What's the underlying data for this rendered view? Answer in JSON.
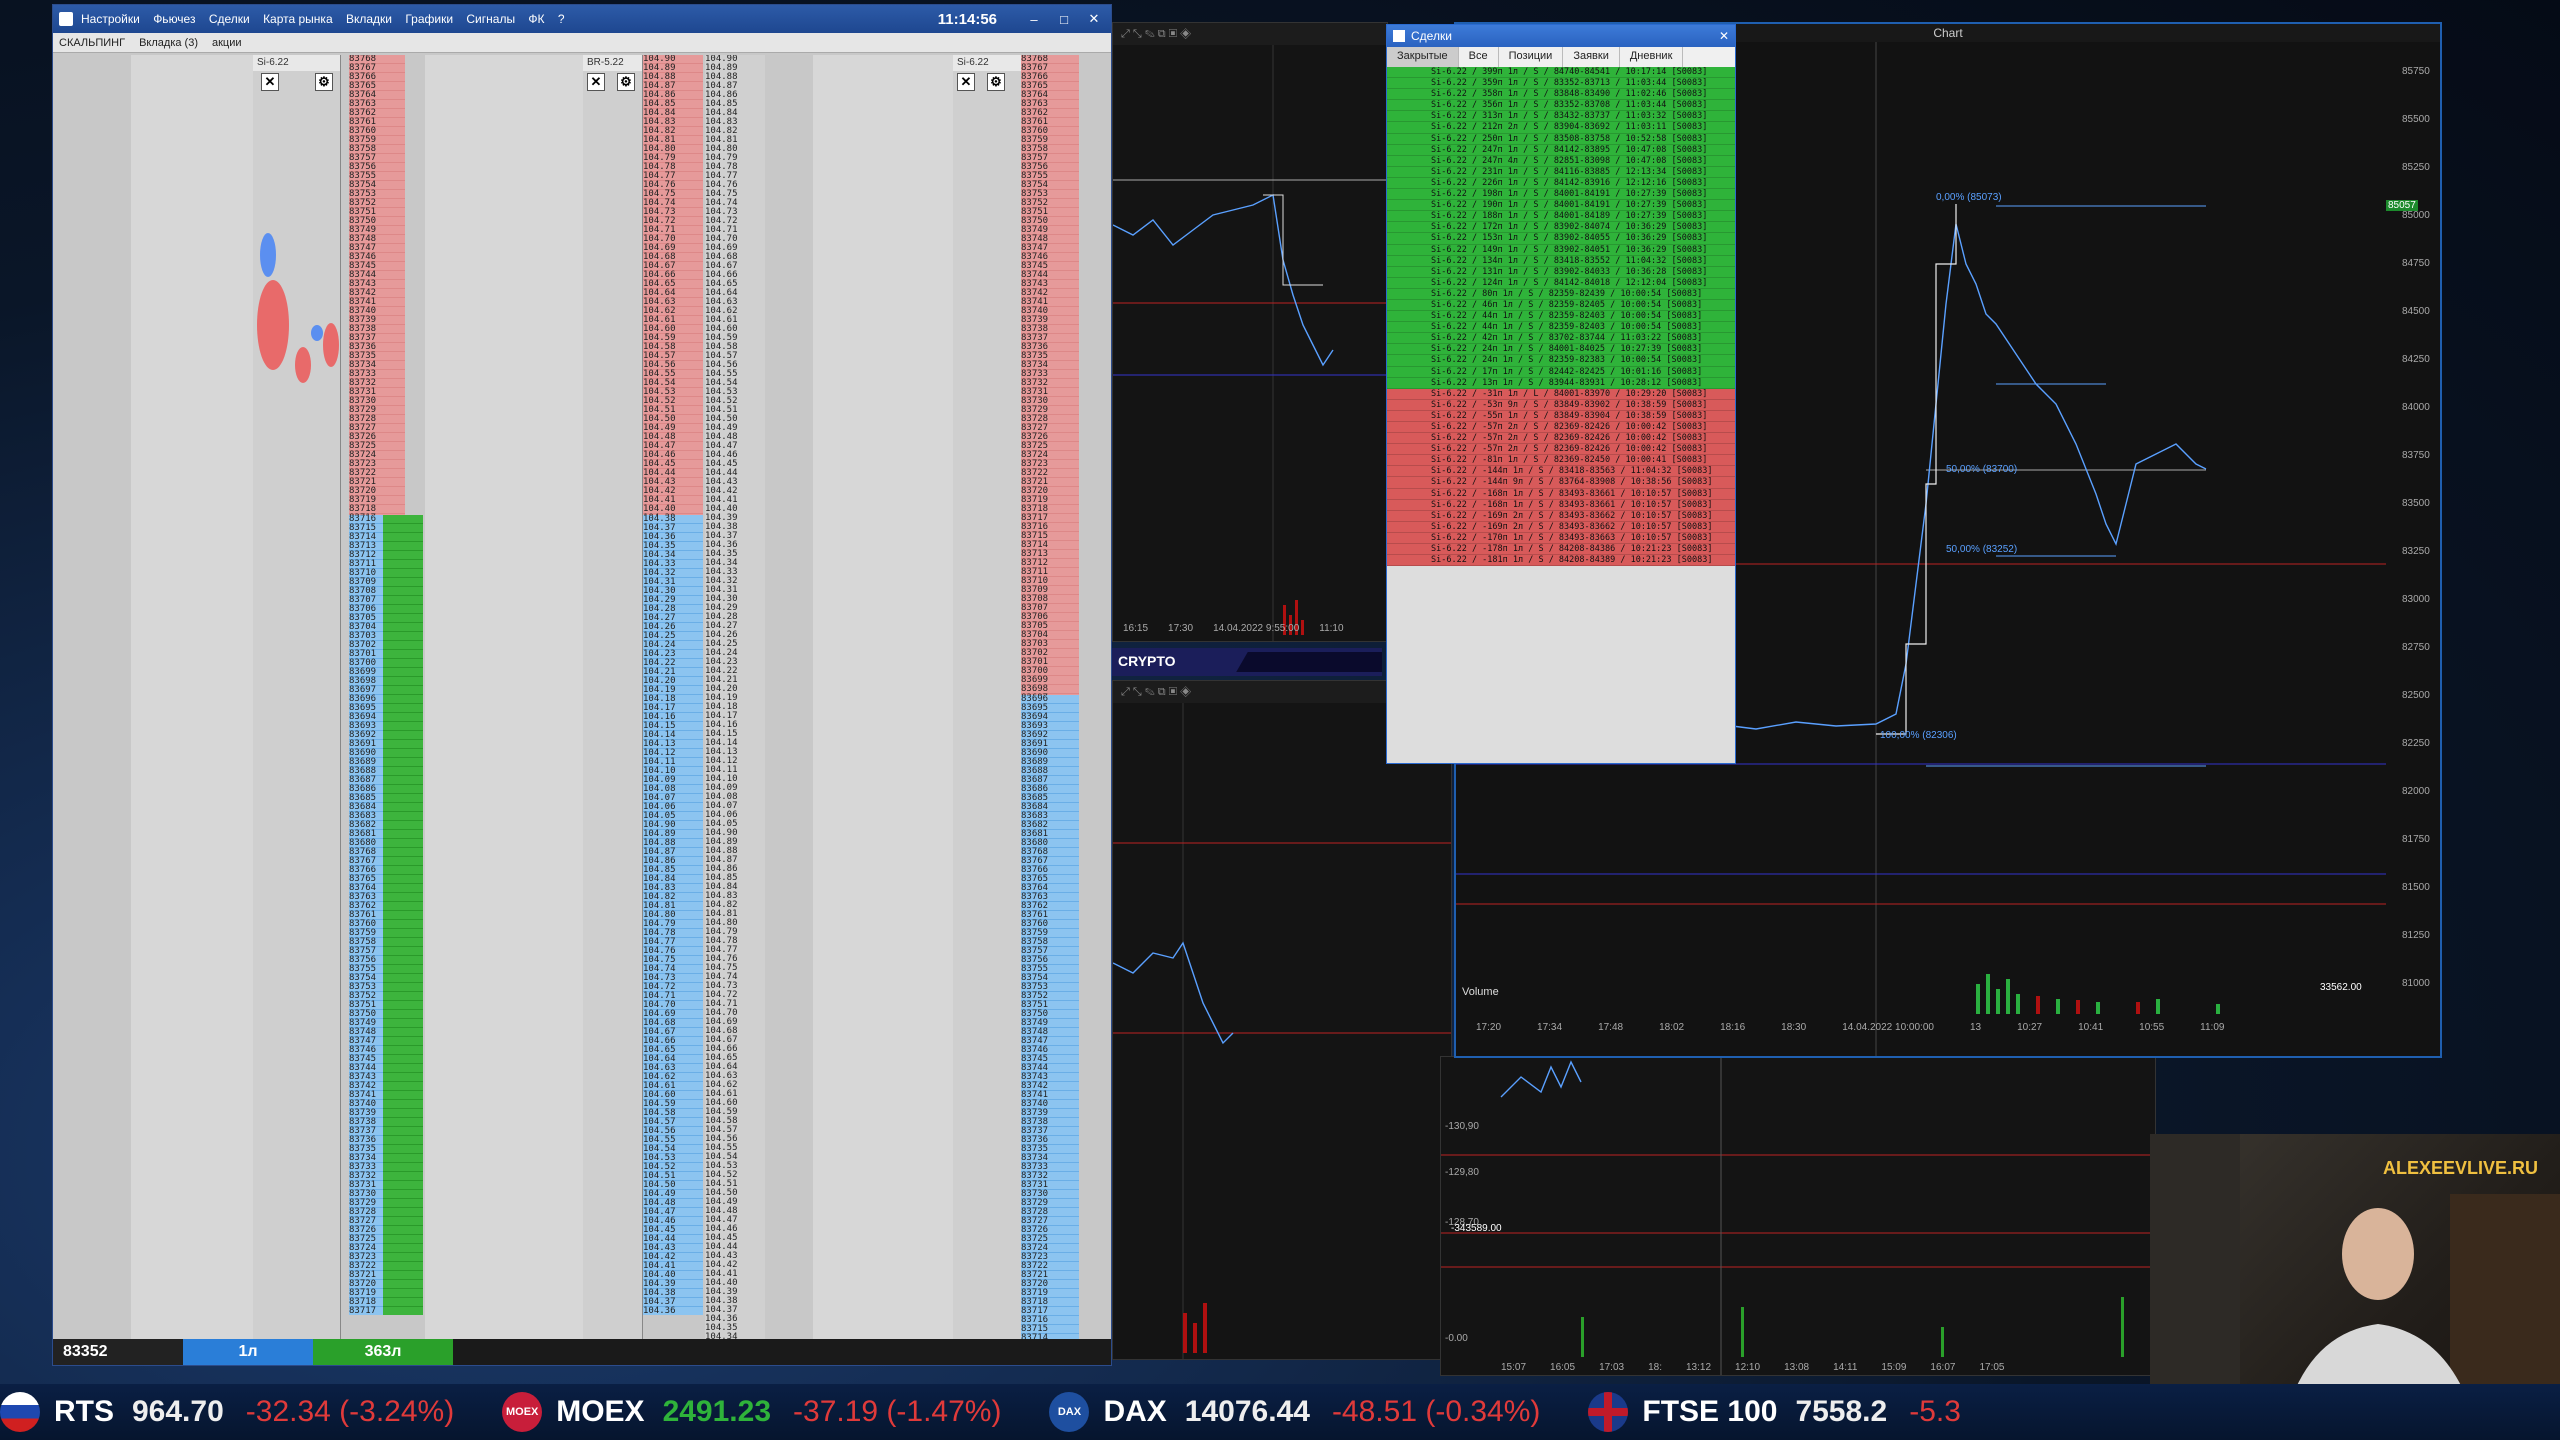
{
  "terminal": {
    "menu": [
      "Настройки",
      "Фьючез",
      "Сделки",
      "Карта рынка",
      "Вкладки",
      "Графики",
      "Сигналы",
      "ФК",
      "?"
    ],
    "clock": "11:14:56",
    "tabs": [
      "СКАЛЬПИНГ",
      "Вкладка (3)",
      "акции"
    ],
    "ladders": [
      {
        "name": "Si-6.22",
        "header_alt": "BR-5.22"
      },
      {
        "name": "Si-6.22"
      }
    ],
    "price_col1": [
      "83768",
      "83767",
      "83766",
      "83765",
      "83764",
      "83763",
      "83762",
      "83761",
      "83760",
      "83759",
      "83758",
      "83757",
      "83756",
      "83755",
      "83754",
      "83753",
      "83752",
      "83751",
      "83750",
      "83749",
      "83748",
      "83747",
      "83746",
      "83745",
      "83744",
      "83743",
      "83742",
      "83741",
      "83740",
      "83739",
      "83738",
      "83737",
      "83736",
      "83735",
      "83734",
      "83733",
      "83732",
      "83731",
      "83730",
      "83729",
      "83728",
      "83727",
      "83726",
      "83725",
      "83724",
      "83723",
      "83722",
      "83721",
      "83720",
      "83719",
      "83718",
      "83717",
      "83716",
      "83715",
      "83714",
      "83713",
      "83712",
      "83711",
      "83710",
      "83709",
      "83708",
      "83707",
      "83706",
      "83705",
      "83704",
      "83703",
      "83702",
      "83701",
      "83700",
      "83699",
      "83698",
      "83697",
      "83696",
      "83695",
      "83694",
      "83693",
      "83692",
      "83691",
      "83690",
      "83689",
      "83688",
      "83687",
      "83686",
      "83685",
      "83684",
      "83683",
      "83682",
      "83681",
      "83680"
    ],
    "price_col2": [
      "104.90",
      "104.89",
      "104.88",
      "104.87",
      "104.86",
      "104.85",
      "104.84",
      "104.83",
      "104.82",
      "104.81",
      "104.80",
      "104.79",
      "104.78",
      "104.77",
      "104.76",
      "104.75",
      "104.74",
      "104.73",
      "104.72",
      "104.71",
      "104.70",
      "104.69",
      "104.68",
      "104.67",
      "104.66",
      "104.65",
      "104.64",
      "104.63",
      "104.62",
      "104.61",
      "104.60",
      "104.59",
      "104.58",
      "104.57",
      "104.56",
      "104.55",
      "104.54",
      "104.53",
      "104.52",
      "104.51",
      "104.50",
      "104.49",
      "104.48",
      "104.47",
      "104.46",
      "104.45",
      "104.44",
      "104.43",
      "104.42",
      "104.41",
      "104.40",
      "104.39",
      "104.38",
      "104.37",
      "104.36",
      "104.35",
      "104.34",
      "104.33",
      "104.32",
      "104.31",
      "104.30",
      "104.29",
      "104.28",
      "104.27",
      "104.26",
      "104.25",
      "104.24",
      "104.23",
      "104.22",
      "104.21",
      "104.20",
      "104.19",
      "104.18",
      "104.17",
      "104.16",
      "104.15",
      "104.14",
      "104.13",
      "104.12",
      "104.11",
      "104.10",
      "104.09",
      "104.08",
      "104.07",
      "104.06",
      "104.05"
    ],
    "footer": {
      "price": "83352",
      "lots1": "1л",
      "lots2": "363л"
    }
  },
  "crypto": {
    "label": "CRYPTO"
  },
  "deals": {
    "title": "Сделки",
    "tabs": [
      "Закрытые",
      "Все",
      "Позиции",
      "Заявки",
      "Дневник"
    ],
    "buy_rows": [
      "Si-6.22 / 399п 1л / S / 84740-84541 / 10:17:14 [S0083]",
      "Si-6.22 / 359п 1л / S / 83352-83713 / 11:03:44 [S0083]",
      "Si-6.22 / 358п 1л / S / 83848-83490 / 11:02:46 [S0083]",
      "Si-6.22 / 356п 1л / S / 83352-83708 / 11:03:44 [S0083]",
      "Si-6.22 / 313п 1л / S / 83432-83737 / 11:03:32 [S0083]",
      "Si-6.22 / 212п 2л / S / 83904-83692 / 11:03:11 [S0083]",
      "Si-6.22 / 250п 1л / S / 83508-83758 / 10:52:58 [S0083]",
      "Si-6.22 / 247п 1л / S / 84142-83895 / 10:47:08 [S0083]",
      "Si-6.22 / 247п 4л / S / 82851-83098 / 10:47:08 [S0083]",
      "Si-6.22 / 231п 1л / S / 84116-83885 / 12:13:34 [S0083]",
      "Si-6.22 / 226п 1л / S / 84142-83916 / 12:12:16 [S0083]",
      "Si-6.22 / 198п 1л / S / 84001-84191 / 10:27:39 [S0083]",
      "Si-6.22 / 190п 1л / S / 84001-84191 / 10:27:39 [S0083]",
      "Si-6.22 / 188п 1л / S / 84001-84189 / 10:27:39 [S0083]",
      "Si-6.22 / 172п 1л / S / 83902-84074 / 10:36:29 [S0083]",
      "Si-6.22 / 153п 1л / S / 83902-84055 / 10:36:29 [S0083]",
      "Si-6.22 / 149п 1л / S / 83902-84051 / 10:36:29 [S0083]",
      "Si-6.22 / 134п 1л / S / 83418-83552 / 11:04:32 [S0083]",
      "Si-6.22 / 131п 1л / S / 83902-84033 / 10:36:28 [S0083]",
      "Si-6.22 / 124п 1л / S / 84142-84018 / 12:12:04 [S0083]",
      "Si-6.22 / 80п 1л / S / 82359-82439 / 10:00:54 [S0083]",
      "Si-6.22 / 46п 1л / S / 82359-82405 / 10:00:54 [S0083]",
      "Si-6.22 / 44п 1л / S / 82359-82403 / 10:00:54 [S0083]",
      "Si-6.22 / 44п 1л / S / 82359-82403 / 10:00:54 [S0083]",
      "Si-6.22 / 42п 1л / S / 83702-83744 / 11:03:22 [S0083]",
      "Si-6.22 / 24п 1л / S / 84001-84025 / 10:27:39 [S0083]",
      "Si-6.22 / 24п 1л / S / 82359-82383 / 10:00:54 [S0083]",
      "Si-6.22 / 17п 1л / S / 82442-82425 / 10:01:16 [S0083]",
      "Si-6.22 / 13п 1л / S / 83944-83931 / 10:28:12 [S0083]"
    ],
    "sell_rows": [
      "Si-6.22 / -31п 1л / L / 84001-83970 / 10:29:20 [S0083]",
      "Si-6.22 / -53п 9л / S / 83849-83902 / 10:38:59 [S0083]",
      "Si-6.22 / -55п 1л / S / 83849-83904 / 10:38:59 [S0083]",
      "Si-6.22 / -57п 2л / S / 82369-82426 / 10:00:42 [S0083]",
      "Si-6.22 / -57п 2л / S / 82369-82426 / 10:00:42 [S0083]",
      "Si-6.22 / -57п 2л / S / 82369-82426 / 10:00:42 [S0083]",
      "Si-6.22 / -81п 1л / S / 82369-82450 / 10:00:41 [S0083]",
      "Si-6.22 / -144п 1л / S / 83418-83563 / 11:04:32 [S0083]",
      "Si-6.22 / -144п 9л / S / 83764-83908 / 10:38:56 [S0083]",
      "Si-6.22 / -168п 1л / S / 83493-83661 / 10:10:57 [S0083]",
      "Si-6.22 / -168п 1л / S / 83493-83661 / 10:10:57 [S0083]",
      "Si-6.22 / -169п 2л / S / 83493-83662 / 10:10:57 [S0083]",
      "Si-6.22 / -169п 2л / S / 83493-83662 / 10:10:57 [S0083]",
      "Si-6.22 / -170п 1л / S / 83493-83663 / 10:10:57 [S0083]",
      "Si-6.22 / -178п 1л / S / 84208-84386 / 10:21:23 [S0083]",
      "Si-6.22 / -181п 1л / S / 84208-84389 / 10:21:23 [S0083]"
    ]
  },
  "main_chart": {
    "title": "Chart",
    "y_ticks": [
      "85750",
      "85500",
      "85250",
      "85000",
      "84750",
      "84500",
      "84250",
      "84000",
      "83750",
      "83500",
      "83250",
      "83000",
      "82750",
      "82500",
      "82250",
      "82000",
      "81750",
      "81500",
      "81250",
      "81000"
    ],
    "x_ticks": [
      "17:20",
      "17:34",
      "17:48",
      "18:02",
      "18:16",
      "18:30",
      "14.04.2022 10:00:00",
      "13",
      "10:27",
      "10:41",
      "10:55",
      "11:09"
    ],
    "volume_label": "Volume",
    "volume_value": "33562.00",
    "fib_labels": [
      "0,00% (85073)",
      "50,00% (83700)",
      "50,00% (83252)",
      "100,00% (82306)"
    ],
    "last_price_tag": "85057"
  },
  "left_chart": {
    "x_ticks": [
      "16:15",
      "17:30",
      "14.04.2022 9:55:00",
      "11:10"
    ]
  },
  "lower_chart": {
    "y_ticks": [
      "-130,90",
      "-129,80",
      "-128,70",
      "-0.00"
    ],
    "x_ticks": [
      "15:07",
      "16:05",
      "17:03",
      "18:",
      "13:12",
      "12:10",
      "13:08",
      "14:11",
      "15:09",
      "16:07",
      "17:05"
    ],
    "value_tag": "-343589.00"
  },
  "webcam": {
    "brand": "ALEXEEVLIVE.RU"
  },
  "ticker": [
    {
      "sym": "RTS",
      "val": "964.70",
      "chg": "-32.34 (-3.24%)",
      "logo": "",
      "logo_color": "#d02020"
    },
    {
      "sym": "MOEX",
      "val": "2491.23",
      "chg": "-37.19 (-1.47%)",
      "logo": "MOEX",
      "logo_color": "#c81e3a"
    },
    {
      "sym": "DAX",
      "val": "14076.44",
      "chg": "-48.51 (-0.34%)",
      "logo": "DAX",
      "logo_color": "#1e4fa0"
    },
    {
      "sym": "FTSE 100",
      "val": "7558.2",
      "chg": "-5.3",
      "logo": "",
      "logo_color": "#1a3a8a"
    }
  ],
  "colors": {
    "buy": "#2fb33a",
    "sell": "#d85a5a",
    "bid": "#8cc4f0",
    "ask": "#e69a9a",
    "loss": "#e03a3a"
  }
}
